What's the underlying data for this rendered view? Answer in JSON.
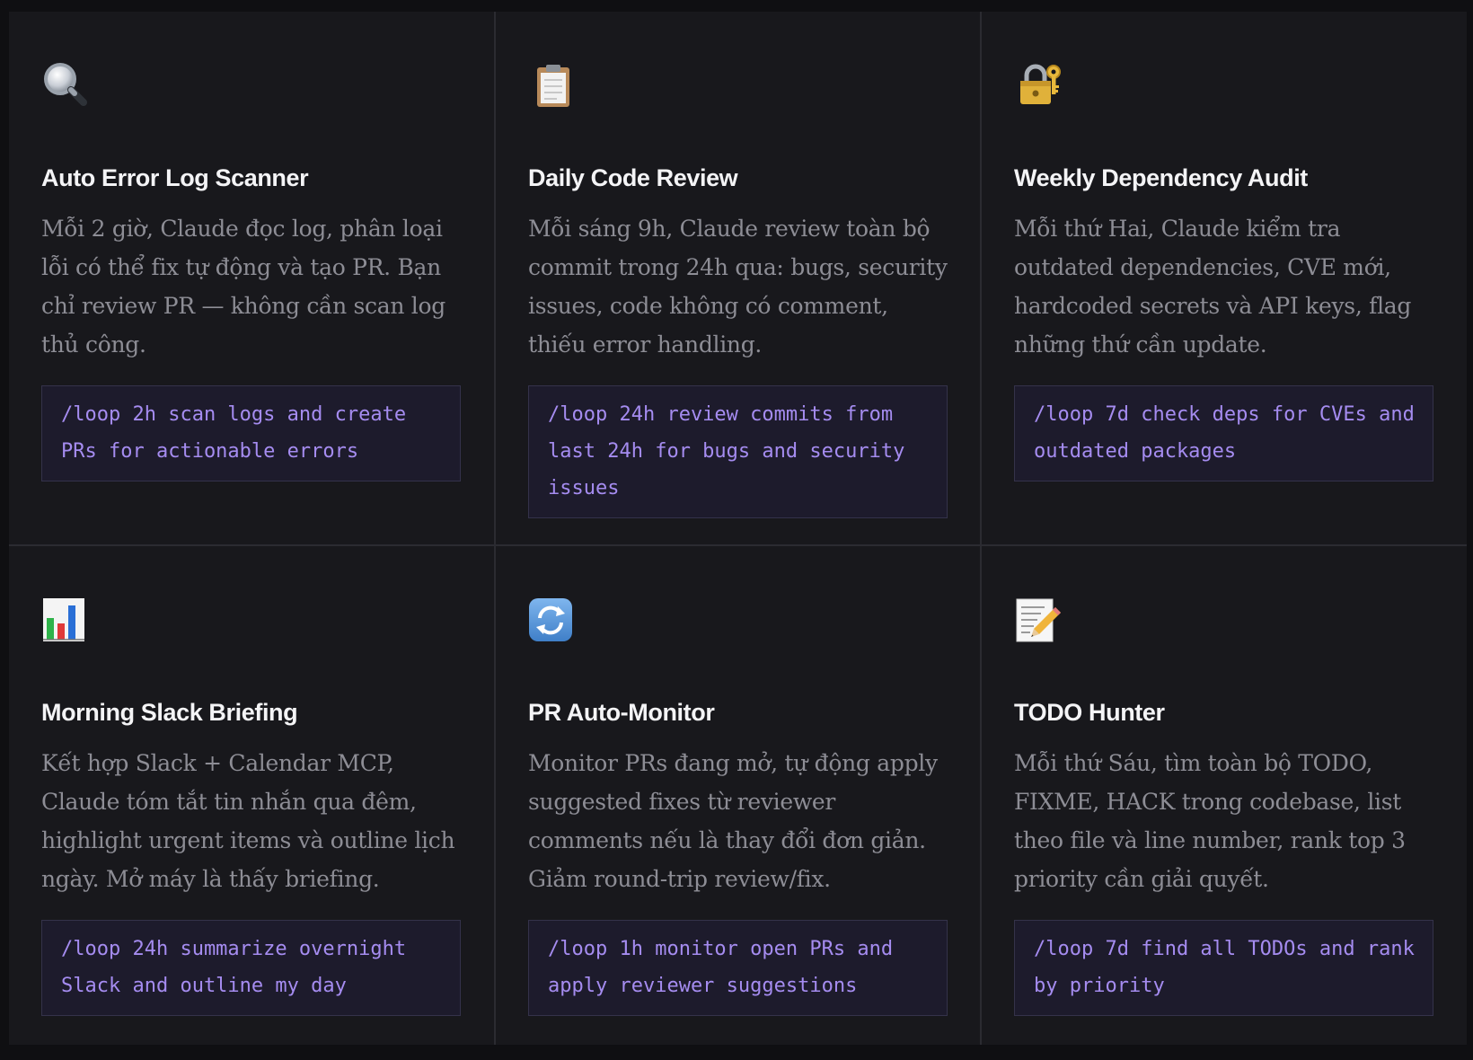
{
  "cards": [
    {
      "icon": "magnifying-glass-icon",
      "title": "Auto Error Log Scanner",
      "description": "Mỗi 2 giờ, Claude đọc log, phân loại lỗi có thể fix tự động và tạo PR. Bạn chỉ review PR — không cần scan log thủ công.",
      "command": "/loop 2h scan logs and create PRs for actionable errors"
    },
    {
      "icon": "clipboard-icon",
      "title": "Daily Code Review",
      "description": "Mỗi sáng 9h, Claude review toàn bộ commit trong 24h qua: bugs, security issues, code không có comment, thiếu error handling.",
      "command": "/loop 24h review commits from last 24h for bugs and security issues"
    },
    {
      "icon": "lock-with-key-icon",
      "title": "Weekly Dependency Audit",
      "description": "Mỗi thứ Hai, Claude kiểm tra outdated dependencies, CVE mới, hardcoded secrets và API keys, flag những thứ cần update.",
      "command": "/loop 7d check deps for CVEs and outdated packages"
    },
    {
      "icon": "bar-chart-icon",
      "title": "Morning Slack Briefing",
      "description": "Kết hợp Slack + Calendar MCP, Claude tóm tắt tin nhắn qua đêm, highlight urgent items và outline lịch ngày. Mở máy là thấy briefing.",
      "command": "/loop 24h summarize overnight Slack and outline my day"
    },
    {
      "icon": "refresh-arrows-icon",
      "title": "PR Auto-Monitor",
      "description": "Monitor PRs đang mở, tự động apply suggested fixes từ reviewer comments nếu là thay đổi đơn giản. Giảm round-trip review/fix.",
      "command": "/loop 1h monitor open PRs and apply reviewer suggestions"
    },
    {
      "icon": "memo-pencil-icon",
      "title": "TODO Hunter",
      "description": "Mỗi thứ Sáu, tìm toàn bộ TODO, FIXME, HACK trong codebase, list theo file và line number, rank top 3 priority cần giải quyết.",
      "command": "/loop 7d find all TODOs and rank by priority"
    }
  ],
  "colors": {
    "background": "#18181c",
    "title": "#f4f4f6",
    "description": "#8d8d95",
    "command_text": "#a58cf0",
    "command_bg": "#1d1b2c"
  }
}
